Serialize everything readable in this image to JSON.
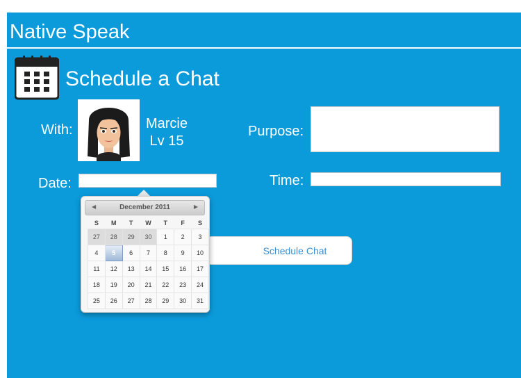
{
  "app": {
    "title": "Native Speak"
  },
  "section": {
    "title": "Schedule a Chat"
  },
  "form": {
    "with_label": "With:",
    "purpose_label": "Purpose:",
    "date_label": "Date:",
    "time_label": "Time:",
    "purpose_value": "",
    "date_value": "",
    "time_value": "",
    "schedule_button": "Schedule Chat"
  },
  "user": {
    "name": "Marcie",
    "level": "Lv 15"
  },
  "datepicker": {
    "month_label": "December 2011",
    "weekdays": [
      "S",
      "M",
      "T",
      "W",
      "T",
      "F",
      "S"
    ],
    "selected_day": "5",
    "weeks": [
      [
        "27",
        "28",
        "29",
        "30",
        "1",
        "2",
        "3"
      ],
      [
        "4",
        "5",
        "6",
        "7",
        "8",
        "9",
        "10"
      ],
      [
        "11",
        "12",
        "13",
        "14",
        "15",
        "16",
        "17"
      ],
      [
        "18",
        "19",
        "20",
        "21",
        "22",
        "23",
        "24"
      ],
      [
        "25",
        "26",
        "27",
        "28",
        "29",
        "30",
        "31"
      ]
    ],
    "other_month_cells": [
      "27",
      "28",
      "29",
      "30"
    ]
  },
  "colors": {
    "background": "#0b9bdb",
    "text": "#ffffff",
    "button_text": "#3a8fd0"
  }
}
